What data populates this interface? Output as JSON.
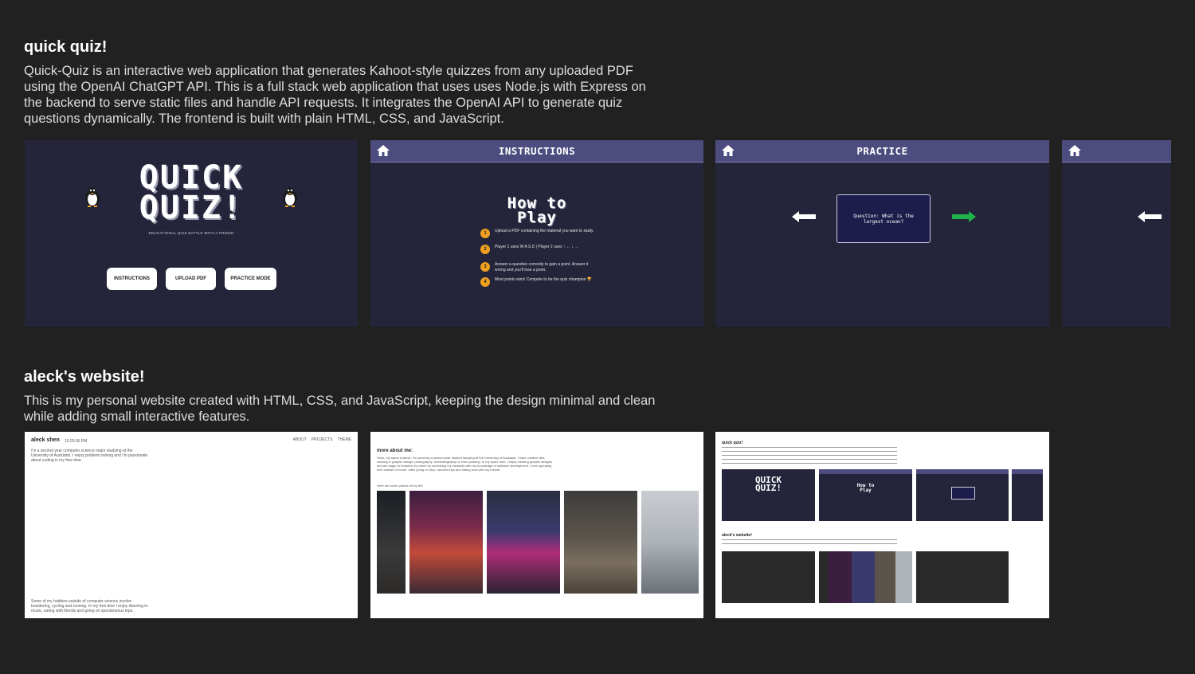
{
  "projects": [
    {
      "title": "quick quiz!",
      "description": "Quick-Quiz is an interactive web application that generates Kahoot-style quizzes from any uploaded PDF using the OpenAI ChatGPT API. This is a full stack web application that uses uses Node.js with Express on the backend to serve static files and handle API requests. It integrates the OpenAI API to generate quiz questions dynamically. The frontend is built with plain HTML, CSS, and JavaScript.",
      "home": {
        "logo_line1": "QUICK",
        "logo_line2": "QUIZ!",
        "tagline": "EDUCATIONAL QUIZ BATTLE WITH A FRIEND",
        "buttons": [
          "INSTRUCTIONS",
          "UPLOAD PDF",
          "PRACTICE MODE"
        ]
      },
      "instructions": {
        "title": "INSTRUCTIONS",
        "heading_line1": "How to",
        "heading_line2": "Play",
        "steps": [
          {
            "num": "1",
            "text": "Upload a PDF containing the material you want to study."
          },
          {
            "num": "2",
            "text": "Player 1 uses W A S D | Player 2 uses ↑ ← ↓ →"
          },
          {
            "num": "3",
            "text": "Answer a question correctly to gain a point. Answer it wrong and you'll lose a point."
          },
          {
            "num": "4",
            "text": "Most points wins! Compete to be the quiz champion 🏆"
          }
        ]
      },
      "practice": {
        "title": "PRACTICE",
        "card_text": "Question: What is the largest ocean?"
      }
    },
    {
      "title": "aleck's website!",
      "description": "This is my personal website created with HTML, CSS, and JavaScript, keeping the design minimal and clean while adding small interactive features.",
      "site": {
        "name": "aleck shen",
        "time": "10:29:30 PM",
        "nav": [
          "ABOUT",
          "PROJECTS",
          "THEME"
        ],
        "intro": "i'm a second year computer science major studying at the University of Auckland. I enjoy problem solving and I'm passionate about coding in my free time.",
        "footer": "Some of my hobbies outside of computer science involve bouldering, cycling and running. In my free time I enjoy listening to music, eating with friends and going on spontaneous trips.",
        "about_heading": "more about me:",
        "about_text": "Hello, my name is Aleck. I'm currently a second year student studying at the University of Auckland. I have creative arts, working in graphic design, photography, cinematography or even painting. In my spare time, I enjoy creating graphic designs and am eager to broaden my reach by combining my creativity with my knowledge of software development. I love spending time outside of home, often going on trips, random trips and eating food with my friends.",
        "photos_caption": "Here are some photos of my life!",
        "mini_heading1": "quick quiz!",
        "mini_heading2": "aleck's website!"
      }
    }
  ],
  "colors": {
    "background": "#212121",
    "quiz_bg": "#24253a",
    "quiz_bar": "#4d4c7f",
    "accent_orange": "#f0a11f",
    "arrow_green": "#1fb34a"
  }
}
